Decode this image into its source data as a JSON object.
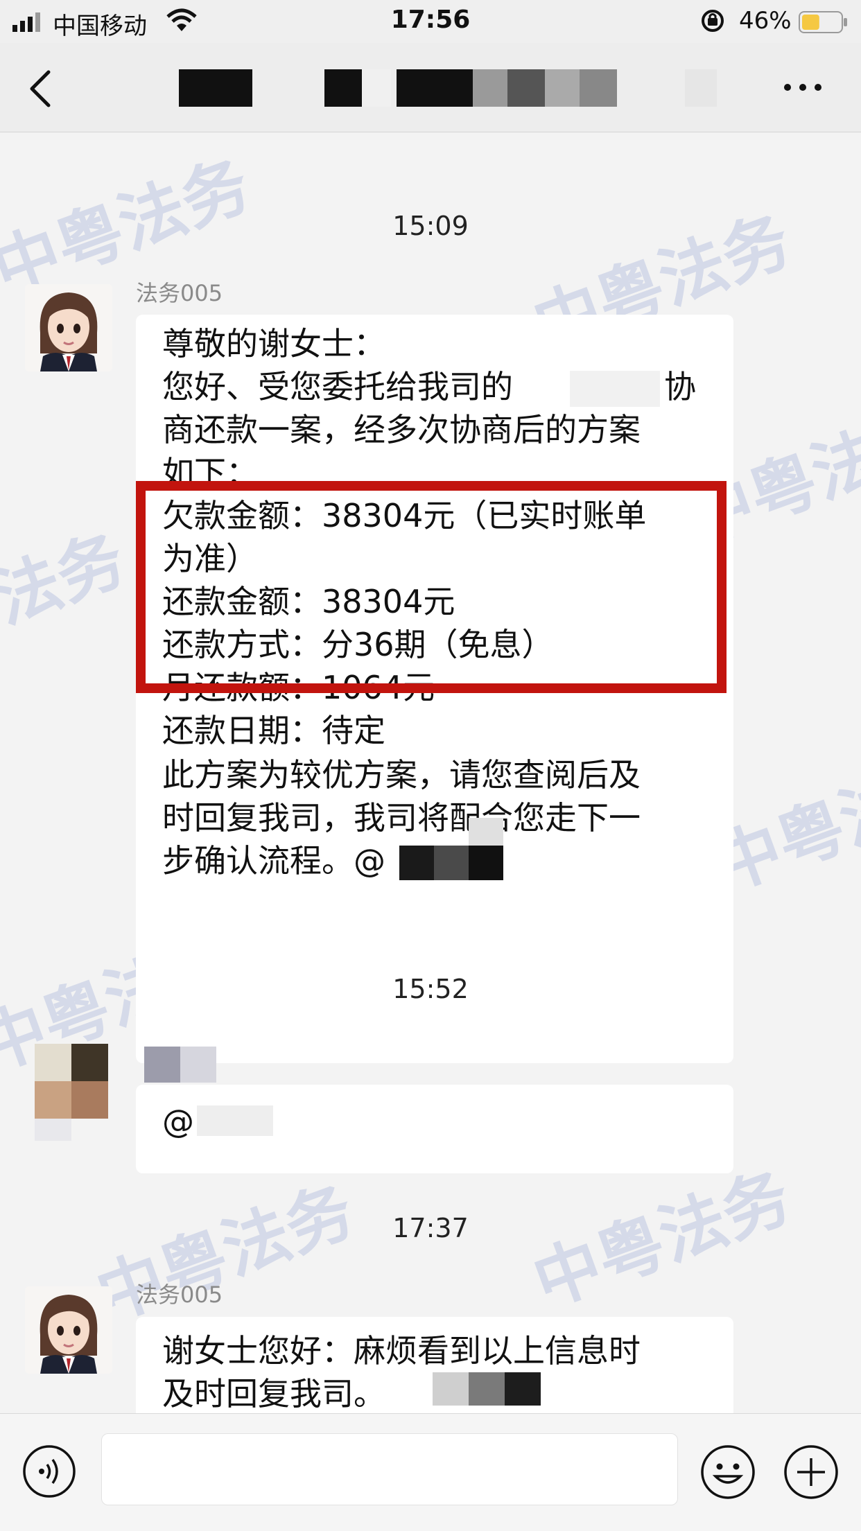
{
  "status_bar": {
    "carrier": "中国移动",
    "time": "17:56",
    "battery_percent": "46%",
    "battery_level": 0.46
  },
  "nav": {
    "back_icon": "chevron-left-icon",
    "more_icon": "ellipsis-icon"
  },
  "watermark": {
    "text": "中粤法务",
    "color": "#6e82c8"
  },
  "messages": [
    {
      "timestamp": "15:09",
      "sender": "法务005",
      "lines": [
        "尊敬的谢女士：",
        "您好、受您委托给我司的",
        "协",
        "商还款一案，经多次协商后的方案",
        "如下：",
        "欠款金额：38304元（已实时账单",
        "为准）",
        "还款金额：38304元",
        "还款方式：分36期（免息）",
        "月还款额：1064元",
        "还款日期：待定",
        "此方案为较优方案，请您查阅后及",
        "时回复我司，我司将配合您走下一",
        "步确认流程。@"
      ]
    },
    {
      "timestamp": "15:52",
      "lines": [
        "@"
      ]
    },
    {
      "timestamp": "17:37",
      "sender": "法务005",
      "lines": [
        "谢女士您好：麻烦看到以上信息时",
        "及时回复我司。"
      ]
    }
  ],
  "input_bar": {
    "voice_icon": "voice-icon",
    "emoji_icon": "emoji-icon",
    "plus_icon": "plus-icon"
  },
  "colors": {
    "highlight_box": "#c2140e",
    "battery_fill": "#f5c842"
  }
}
